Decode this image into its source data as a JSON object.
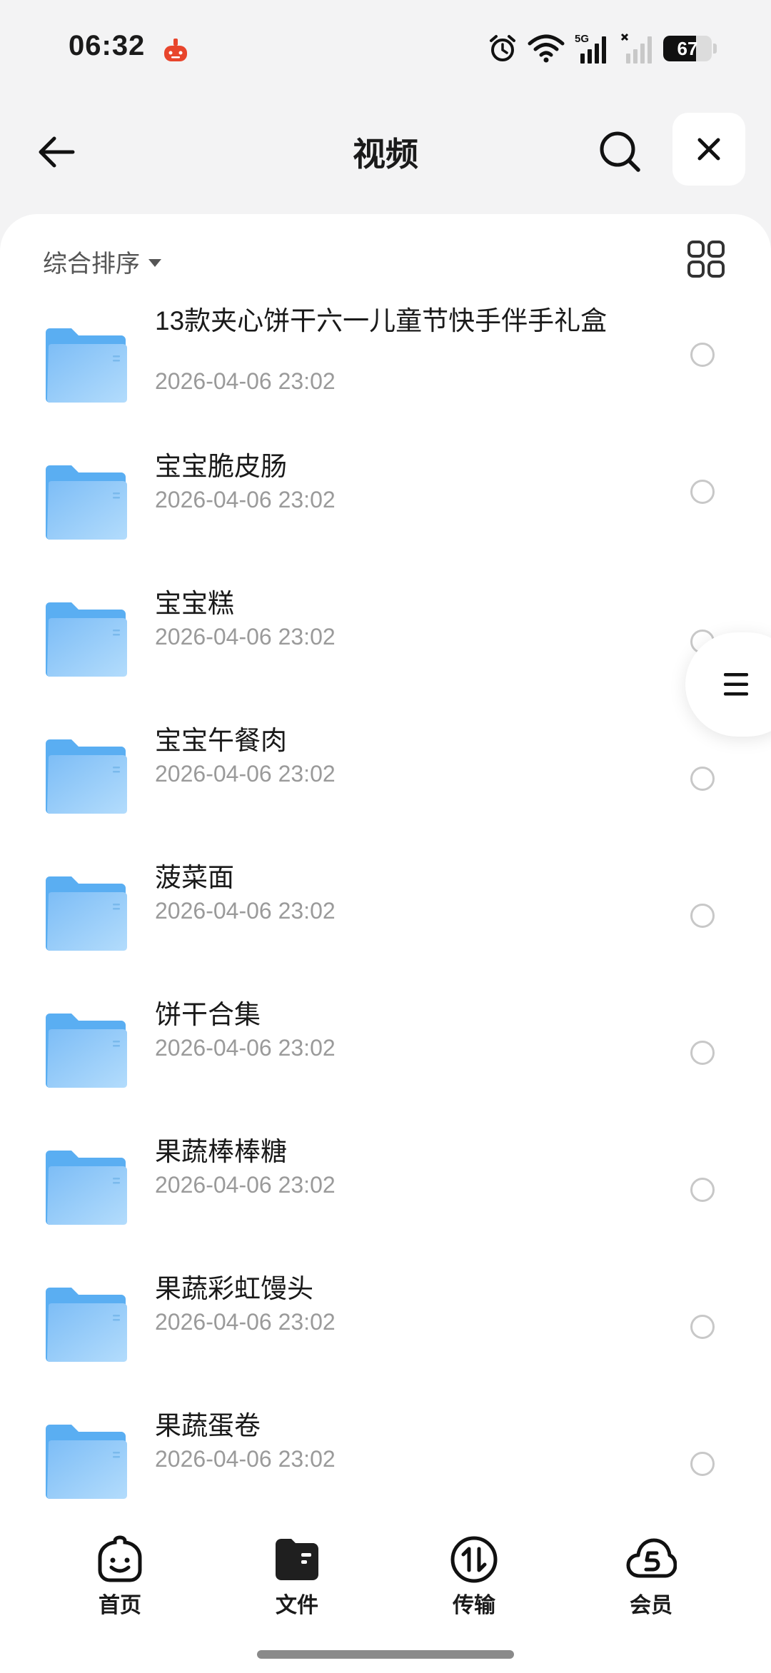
{
  "status_bar": {
    "time": "06:32",
    "battery_level": 67,
    "battery_text": "67",
    "network": "5G",
    "icons": [
      "app-notification-icon",
      "alarm-icon",
      "wifi-icon",
      "signal-5g-icon",
      "signal-no-service-icon",
      "battery-icon"
    ]
  },
  "header": {
    "title": "视频"
  },
  "sort": {
    "label": "综合排序"
  },
  "files": [
    {
      "name": "13款夹心饼干六一儿童节快手伴手礼盒",
      "date": "2026-04-06 23:02"
    },
    {
      "name": "宝宝脆皮肠",
      "date": "2026-04-06 23:02"
    },
    {
      "name": "宝宝糕",
      "date": "2026-04-06 23:02"
    },
    {
      "name": "宝宝午餐肉",
      "date": "2026-04-06 23:02"
    },
    {
      "name": "菠菜面",
      "date": "2026-04-06 23:02"
    },
    {
      "name": "饼干合集",
      "date": "2026-04-06 23:02"
    },
    {
      "name": "果蔬棒棒糖",
      "date": "2026-04-06 23:02"
    },
    {
      "name": "果蔬彩虹馒头",
      "date": "2026-04-06 23:02"
    },
    {
      "name": "果蔬蛋卷",
      "date": "2026-04-06 23:02"
    }
  ],
  "nav": [
    {
      "label": "首页",
      "icon": "home-smile-icon"
    },
    {
      "label": "文件",
      "icon": "folder-icon"
    },
    {
      "label": "传输",
      "icon": "transfer-icon"
    },
    {
      "label": "会员",
      "icon": "vip-cloud-icon"
    }
  ],
  "colors": {
    "background": "#f3f3f4",
    "folder_blue": "#5aaef2",
    "folder_light": "#9fd1fb",
    "text_primary": "#1a1a1a",
    "text_secondary": "#9a9a9a"
  }
}
